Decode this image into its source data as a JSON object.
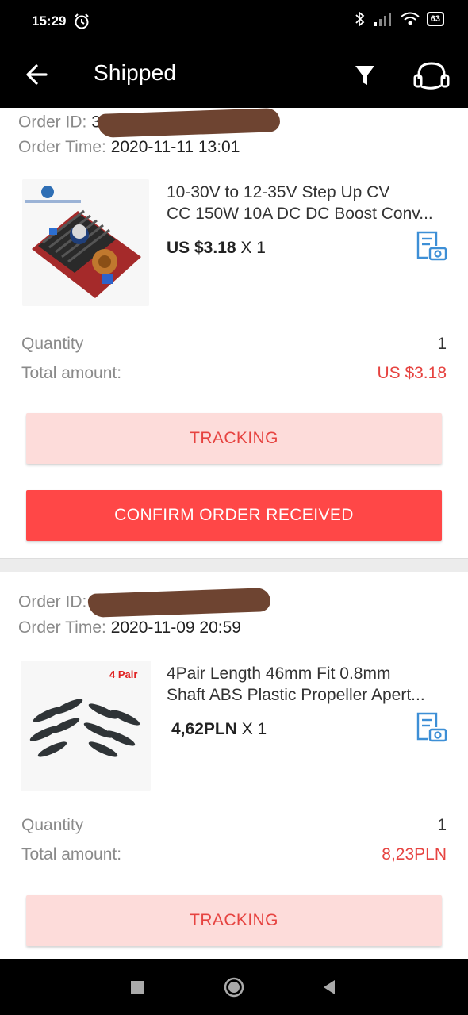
{
  "status_bar": {
    "time": "15:29",
    "battery": "63"
  },
  "app_bar": {
    "title": "Shipped"
  },
  "orders": [
    {
      "order_id_label": "Order ID:",
      "order_time_label": "Order Time:",
      "order_time": "2020-11-11 13:01",
      "title_line1": "10-30V to 12-35V Step Up CV",
      "title_line2": "CC 150W 10A DC DC Boost Conv...",
      "price": "US $3.18",
      "multiplier": "X 1",
      "quantity_label": "Quantity",
      "quantity": "1",
      "total_label": "Total amount:",
      "total": "US $3.18",
      "tracking_label": "TRACKING",
      "confirm_label": "CONFIRM ORDER RECEIVED"
    },
    {
      "order_id_label": "Order ID:",
      "order_time_label": "Order Time:",
      "order_time": "2020-11-09 20:59",
      "thumb_badge": "4 Pair",
      "title_line1": "4Pair Length 46mm Fit 0.8mm",
      "title_line2": "Shaft ABS Plastic Propeller Apert...",
      "price": "4,62PLN",
      "multiplier": "X 1",
      "quantity_label": "Quantity",
      "quantity": "1",
      "total_label": "Total amount:",
      "total": "8,23PLN",
      "tracking_label": "TRACKING"
    }
  ],
  "colors": {
    "accent_red": "#ff4747",
    "price_red": "#e64340",
    "tracking_bg": "#fddcda",
    "review_icon_blue": "#3d8fd6"
  }
}
